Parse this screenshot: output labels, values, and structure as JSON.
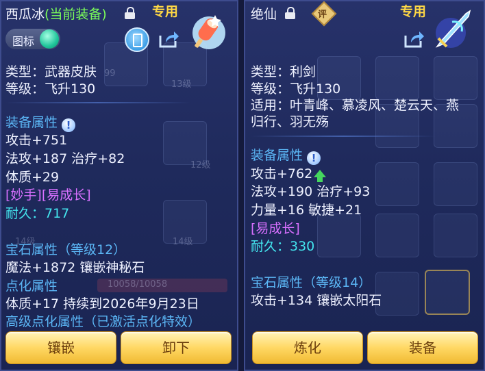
{
  "left": {
    "title_name": "西瓜冰",
    "title_status": "(当前装备)",
    "exclusive": "专用",
    "toggle_label": "图标",
    "attrs": {
      "type": "类型：武器皮肤",
      "level": "等级：飞升130"
    },
    "equip_section": "装备属性",
    "equip": [
      "攻击+751",
      "法攻+187 治疗+82",
      "体质+29"
    ],
    "tags": "[妙手][易成长]",
    "durability": "耐久：717",
    "gem_section": "宝石属性（等级12）",
    "gem": "魔法+1872 镶嵌神秘石",
    "refine_section": "点化属性",
    "refine": "体质+17 持续到2026年9月23日",
    "adv_refine": "高级点化属性（已激活点化特效）",
    "buttons": {
      "inlay": "镶嵌",
      "unequip": "卸下"
    },
    "bg": {
      "level1": "13级",
      "level2": "12级",
      "level3": "14级",
      "level4": "14级",
      "bar": "10058/10058",
      "num": "99"
    }
  },
  "right": {
    "title_name": "绝仙",
    "badge": "评",
    "exclusive": "专用",
    "attrs": {
      "type": "类型：利剑",
      "level": "等级：飞升130",
      "usable1": "适用：叶青峰、慕凌风、楚云天、燕",
      "usable2": "归行、羽无殇"
    },
    "equip_section": "装备属性",
    "equip": [
      "攻击+762",
      "法攻+190 治疗+93",
      "力量+16 敏捷+21"
    ],
    "tags": "[易成长]",
    "durability": "耐久：330",
    "gem_section": "宝石属性（等级14）",
    "gem": "攻击+134 镶嵌太阳石",
    "buttons": {
      "refine": "炼化",
      "equip": "装备"
    }
  },
  "colors": {
    "section": "#5bb6f5",
    "green": "#7cff5a",
    "gold": "#ffd845",
    "purple": "#d870ff",
    "cyan": "#44e6ef"
  }
}
